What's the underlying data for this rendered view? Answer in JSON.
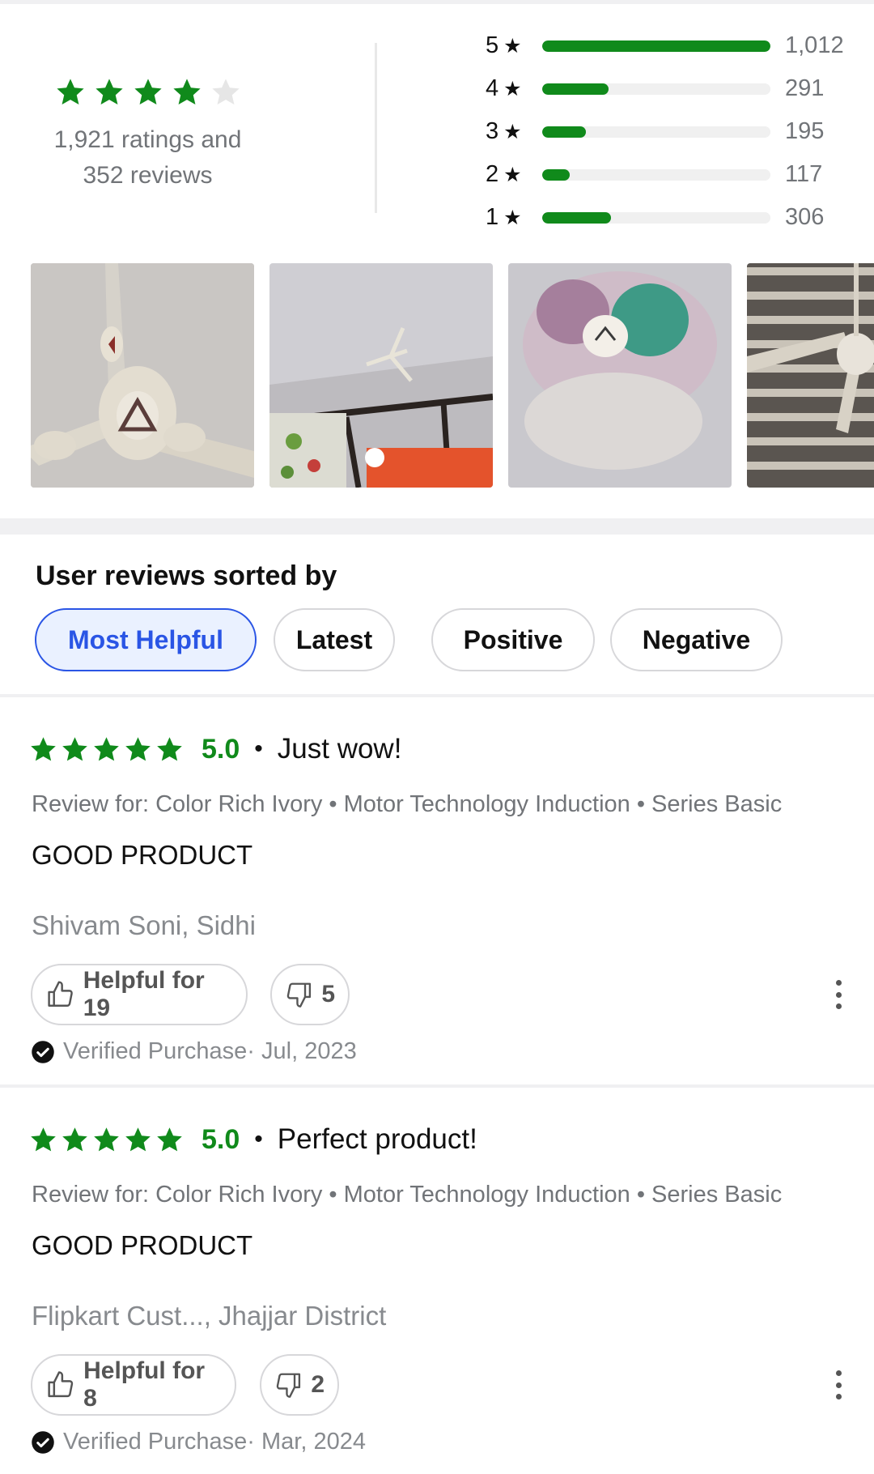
{
  "summary": {
    "average_stars": 4,
    "max_stars": 5,
    "ratings_line": "1,921 ratings and",
    "reviews_line": "352 reviews",
    "breakdown": [
      {
        "stars": "5",
        "count": "1,012",
        "fill": 1.0
      },
      {
        "stars": "4",
        "count": "291",
        "fill": 0.29
      },
      {
        "stars": "3",
        "count": "195",
        "fill": 0.19
      },
      {
        "stars": "2",
        "count": "117",
        "fill": 0.12
      },
      {
        "stars": "1",
        "count": "306",
        "fill": 0.3
      }
    ]
  },
  "photos": [
    "fan-photo-1",
    "fan-photo-2",
    "fan-photo-3",
    "fan-photo-4"
  ],
  "sort": {
    "title": "User reviews sorted by",
    "options": [
      "Most Helpful",
      "Latest",
      "Positive",
      "Negative"
    ],
    "selected": "Most Helpful"
  },
  "reviews": [
    {
      "stars": 5,
      "score": "5.0",
      "dot": "•",
      "title": "Just wow!",
      "variant": "Review for: Color Rich Ivory • Motor Technology Induction • Series Basic",
      "body": "GOOD PRODUCT",
      "author": "Shivam Soni, Sidhi",
      "helpful_label": "Helpful for 19",
      "dislike_count": "5",
      "verified": "Verified Purchase· Jul, 2023"
    },
    {
      "stars": 5,
      "score": "5.0",
      "dot": "•",
      "title": "Perfect product!",
      "variant": "Review for: Color Rich Ivory • Motor Technology Induction • Series Basic",
      "body": "GOOD PRODUCT",
      "author": "Flipkart Cust..., Jhajjar District",
      "helpful_label": "Helpful for 8",
      "dislike_count": "2",
      "verified": "Verified Purchase· Mar, 2024"
    }
  ],
  "colors": {
    "rating_green": "#108a1b",
    "accent_blue": "#2a55e5",
    "muted_text": "#717478",
    "empty_star": "#e6e6e6"
  }
}
